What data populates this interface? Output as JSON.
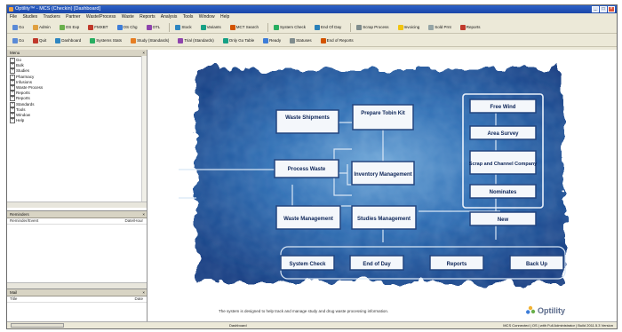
{
  "window": {
    "title": "Optility™ - MCS (Checkin) [Dashboard]"
  },
  "menu": [
    "File",
    "Studies",
    "Trackers",
    "Partner",
    "Waste/Process",
    "Waste",
    "Reports",
    "Analysis",
    "Tools",
    "Window",
    "Help"
  ],
  "toolbar1": [
    "Go",
    "Admin",
    "OS Exp",
    "FMXBT",
    "OS Chg",
    "OTL",
    "Stock",
    "Variants",
    "MCT Search",
    "System Check",
    "End Of Day",
    "Scrap Process",
    "Invoicing",
    "Sold Prnt",
    "Reports"
  ],
  "toolbar2": [
    "Go",
    "Quit",
    "Dashboard",
    "Systems Stats",
    "Study (Standards)",
    "Trial (Standards)",
    "Only Go Table",
    "Ready",
    "Statuses",
    "End of Reports"
  ],
  "menu_pane": {
    "title": "Menu",
    "items": [
      "Go",
      "Bulk",
      "Studies",
      "Pharmacy",
      "Infusions",
      "Waste Process",
      "Reports",
      "Reports",
      "Standards",
      "Tools",
      "Window",
      "Help"
    ]
  },
  "reminders_pane": {
    "title": "Reminders",
    "col_left": "Reminder/Event",
    "col_right": "Date/Hour"
  },
  "mail_pane": {
    "title": "Mail",
    "col_left": "Title",
    "col_right": "Date"
  },
  "flow": {
    "boxes": {
      "waste_shipments": "Waste Shipments",
      "prepare_tobin_kit": "Prepare Tobin Kit",
      "process_waste": "Process Waste",
      "inventory_management": "Inventory Management",
      "waste_management": "Waste Management",
      "studies_management": "Studies Management",
      "free_wind": "Free Wind",
      "area_survey": "Area Survey",
      "scrap_channel_company": "Scrap and Channel Company",
      "nominates": "Nominates",
      "new": "New",
      "system_check": "System Check",
      "end_of_day": "End of Day",
      "reports": "Reports",
      "back_up": "Back Up"
    }
  },
  "footer_text": "The system is designed to help track and manage study and drug waste processing information.",
  "logo_text": "Optility",
  "status": {
    "center": "Dashboard",
    "right": "MCS Connected  |  OS  |  with Full Administrator  |  Build 2011.5.3 Version"
  }
}
